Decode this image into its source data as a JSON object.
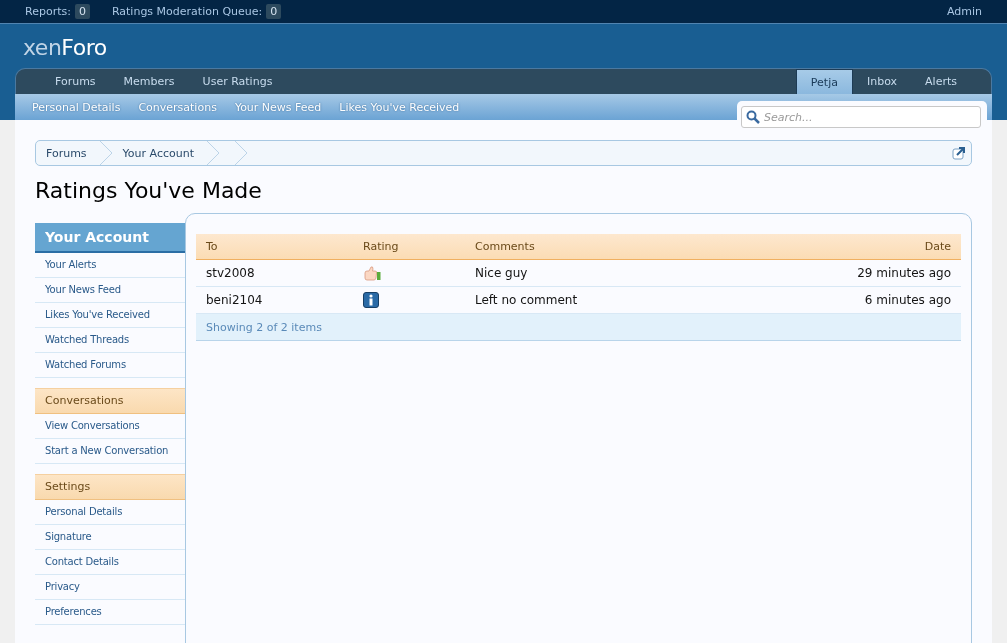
{
  "top_bar": {
    "counters": [
      {
        "label": "Reports:",
        "count": "0"
      },
      {
        "label": "Ratings Moderation Queue:",
        "count": "0"
      }
    ],
    "admin": "Admin"
  },
  "logo": {
    "light": "xen",
    "bold": "Foro"
  },
  "nav": {
    "left": [
      {
        "label": "Forums",
        "selected": false
      },
      {
        "label": "Members",
        "selected": false
      },
      {
        "label": "User Ratings",
        "selected": false
      }
    ],
    "right": [
      {
        "label": "Petja",
        "selected": true
      },
      {
        "label": "Inbox",
        "selected": false
      },
      {
        "label": "Alerts",
        "selected": false
      }
    ]
  },
  "sub_nav": [
    "Personal Details",
    "Conversations",
    "Your News Feed",
    "Likes You've Received"
  ],
  "search": {
    "placeholder": "Search..."
  },
  "breadcrumbs": [
    "Forums",
    "Your Account"
  ],
  "page_title": "Ratings You've Made",
  "sidebar": [
    {
      "heading": "Your Account",
      "kind": "primary",
      "items": [
        "Your Alerts",
        "Your News Feed",
        "Likes You've Received",
        "Watched Threads",
        "Watched Forums"
      ]
    },
    {
      "heading": "Conversations",
      "kind": "secondary",
      "items": [
        "View Conversations",
        "Start a New Conversation"
      ]
    },
    {
      "heading": "Settings",
      "kind": "secondary",
      "items": [
        "Personal Details",
        "Signature",
        "Contact Details",
        "Privacy",
        "Preferences"
      ]
    }
  ],
  "table": {
    "columns": [
      "To",
      "Rating",
      "Comments",
      "Date"
    ],
    "rows": [
      {
        "to": "stv2008",
        "rating": {
          "kind": "like"
        },
        "comment": "Nice guy",
        "date": "29 minutes ago"
      },
      {
        "to": "beni2104",
        "rating": {
          "kind": "info"
        },
        "comment": "Left no comment",
        "date": "6 minutes ago"
      }
    ],
    "footer": "Showing 2 of 2 items"
  }
}
